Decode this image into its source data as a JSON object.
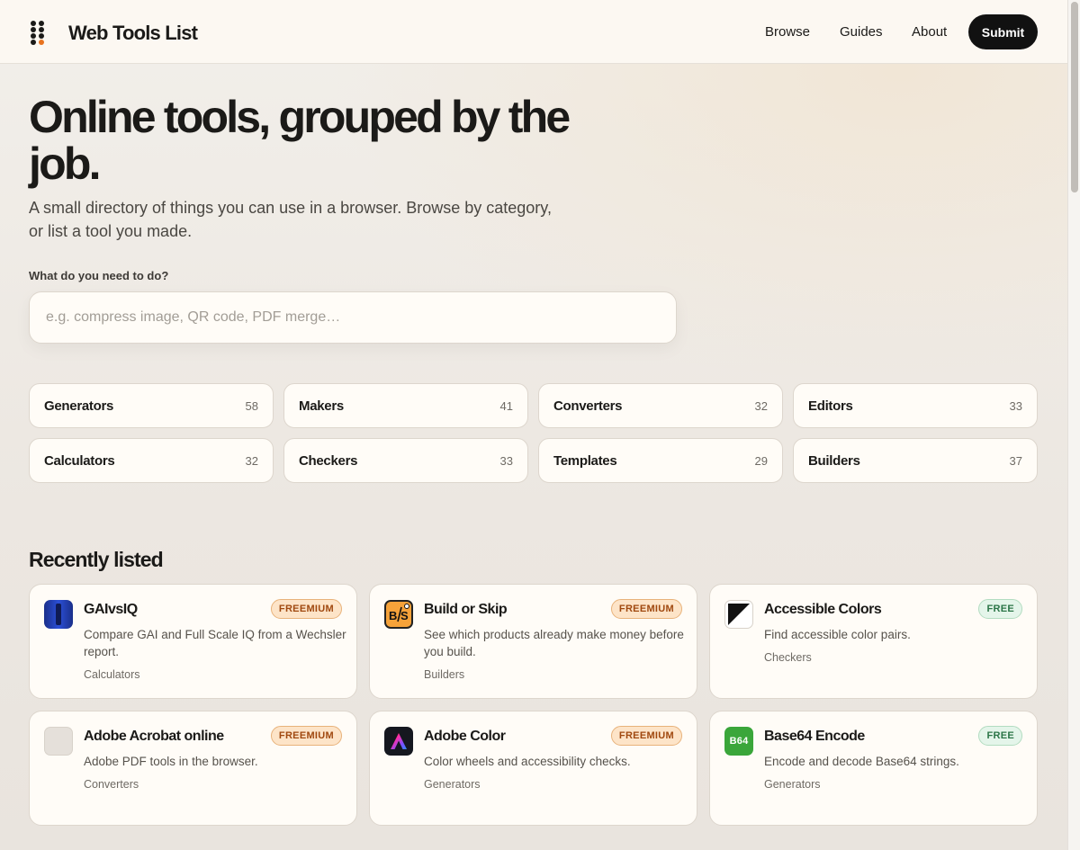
{
  "header": {
    "site_name": "Web Tools List",
    "nav": [
      "Browse",
      "Guides",
      "About"
    ],
    "submit_label": "Submit"
  },
  "hero": {
    "title": "Online tools, grouped by the job.",
    "subtitle": "A small directory of things you can use in a browser. Browse by category, or list a tool you made."
  },
  "search": {
    "label": "What do you need to do?",
    "placeholder": "e.g. compress image, QR code, PDF merge…",
    "value": ""
  },
  "categories": [
    {
      "name": "Generators",
      "count": "58"
    },
    {
      "name": "Makers",
      "count": "41"
    },
    {
      "name": "Converters",
      "count": "32"
    },
    {
      "name": "Editors",
      "count": "33"
    },
    {
      "name": "Calculators",
      "count": "32"
    },
    {
      "name": "Checkers",
      "count": "33"
    },
    {
      "name": "Templates",
      "count": "29"
    },
    {
      "name": "Builders",
      "count": "37"
    }
  ],
  "recent": {
    "title": "Recently listed",
    "tools": [
      {
        "name": "GAIvsIQ",
        "badge": "FREEMIUM",
        "desc": "Compare GAI and Full Scale IQ from a Wechsler report.",
        "category": "Calculators",
        "icon": "gaivsiq-icon"
      },
      {
        "name": "Build or Skip",
        "badge": "FREEMIUM",
        "desc": "See which products already make money before you build.",
        "category": "Builders",
        "icon": "build-or-skip-icon"
      },
      {
        "name": "Accessible Colors",
        "badge": "FREE",
        "desc": "Find accessible color pairs.",
        "category": "Checkers",
        "icon": "accessible-colors-icon"
      },
      {
        "name": "Adobe Acrobat online",
        "badge": "FREEMIUM",
        "desc": "Adobe PDF tools in the browser.",
        "category": "Converters",
        "icon": "placeholder-icon"
      },
      {
        "name": "Adobe Color",
        "badge": "FREEMIUM",
        "desc": "Color wheels and accessibility checks.",
        "category": "Generators",
        "icon": "adobe-color-icon"
      },
      {
        "name": "Base64 Encode",
        "badge": "FREE",
        "desc": "Encode and decode Base64 strings.",
        "category": "Generators",
        "icon": "base64-icon",
        "icon_text": "B64"
      }
    ]
  },
  "colors": {
    "accent_orange": "#e8731f",
    "freemium_bg": "#fde4c8",
    "free_bg": "#e4f5ea",
    "button_dark": "#111111"
  }
}
